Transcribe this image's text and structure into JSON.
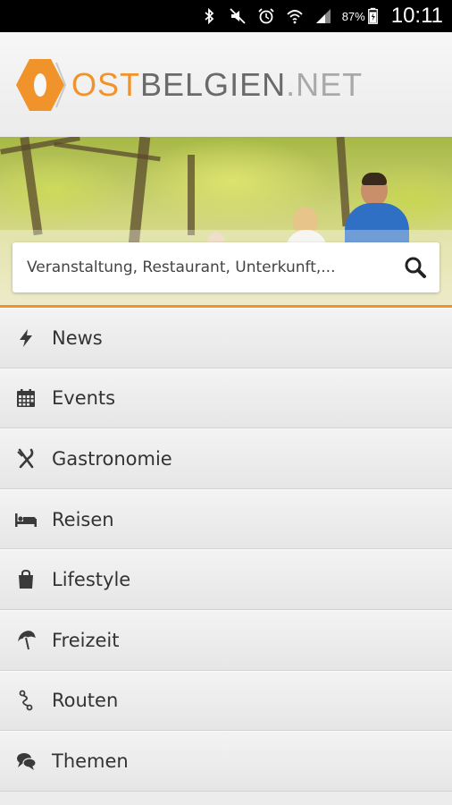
{
  "status_bar": {
    "battery_percent": "87%",
    "time": "10:11",
    "icons": [
      "bluetooth-icon",
      "mute-icon",
      "alarm-icon",
      "wifi-icon",
      "signal-icon",
      "battery-icon"
    ]
  },
  "header": {
    "logo_ost": "OST",
    "logo_belgien": "BELGIEN",
    "logo_net": ".NET",
    "brand_color": "#f0932b"
  },
  "search": {
    "placeholder": "Veranstaltung, Restaurant, Unterkunft,..."
  },
  "menu": {
    "items": [
      {
        "label": "News",
        "icon": "lightning-icon"
      },
      {
        "label": "Events",
        "icon": "calendar-icon"
      },
      {
        "label": "Gastronomie",
        "icon": "cutlery-icon"
      },
      {
        "label": "Reisen",
        "icon": "bed-icon"
      },
      {
        "label": "Lifestyle",
        "icon": "shopping-bag-icon"
      },
      {
        "label": "Freizeit",
        "icon": "umbrella-icon"
      },
      {
        "label": "Routen",
        "icon": "route-icon"
      },
      {
        "label": "Themen",
        "icon": "chat-icon"
      }
    ]
  }
}
